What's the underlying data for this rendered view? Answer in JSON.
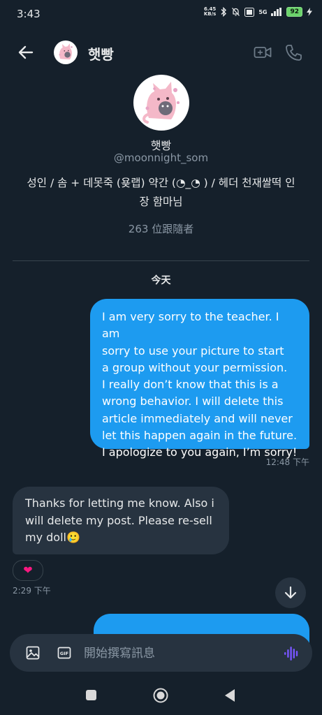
{
  "status_bar": {
    "time": "3:43",
    "net_speed_value": "6.45",
    "net_speed_unit": "KB/s",
    "signal_label": "5G",
    "battery": "92"
  },
  "header": {
    "name": "햇빵",
    "back_icon": "arrow-left-icon",
    "video_icon": "video-camera-icon",
    "phone_icon": "phone-icon"
  },
  "profile": {
    "name": "햇빵",
    "handle": "@moonnight_som",
    "bio_line1": "성인 / 솜 + 데못죽 (욪랩) 약간 (◔_◔ ) / 헤더 천재쌀떡 인",
    "bio_line2": "장 함마님",
    "followers": "263 位跟隨者"
  },
  "conversation": {
    "day_label": "今天",
    "messages": [
      {
        "direction": "out",
        "lines": [
          "I am very sorry to the teacher. I am",
          "sorry to use your picture to start",
          "a group without your permission.",
          "I really don’t know that this is a",
          "wrong behavior. I will delete this",
          "article immediately and will never",
          "let this happen again in the future.",
          "I apologize to you again, I’m sorry!"
        ],
        "time": "12:48 下午"
      },
      {
        "direction": "in",
        "lines": [
          "Thanks for letting me know. Also i",
          "will delete my post. Please re-sell",
          "my doll🥲"
        ],
        "reaction": "❤",
        "time": "2:29 下午"
      }
    ]
  },
  "composer": {
    "placeholder": "開始撰寫訊息",
    "gif_label": "GIF"
  },
  "colors": {
    "background": "#15202b",
    "outgoing_bubble": "#1d9bf0",
    "incoming_bubble": "#273340",
    "muted_text": "#8b98a5",
    "voice_accent": "#7856ff"
  }
}
